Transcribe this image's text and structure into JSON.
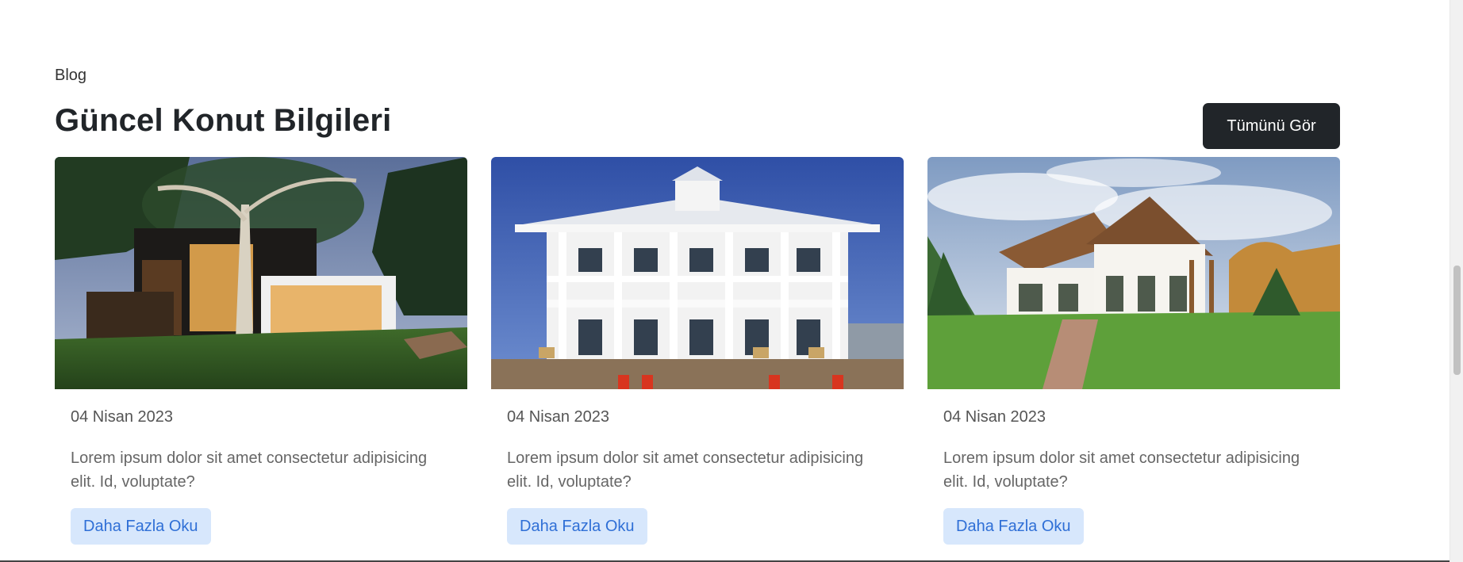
{
  "section": {
    "eyebrow": "Blog",
    "title": "Güncel Konut Bilgileri",
    "see_all_label": "Tümünü Gör"
  },
  "cards": [
    {
      "image_alt": "modern-house-at-dusk",
      "date": "04 Nisan 2023",
      "excerpt": "Lorem ipsum dolor sit amet consectetur adipisicing elit. Id, voluptate?",
      "button_label": "Daha Fazla Oku"
    },
    {
      "image_alt": "white-colonial-house",
      "date": "04 Nisan 2023",
      "excerpt": "Lorem ipsum dolor sit amet consectetur adipisicing elit. Id, voluptate?",
      "button_label": "Daha Fazla Oku"
    },
    {
      "image_alt": "country-house-with-garden",
      "date": "04 Nisan 2023",
      "excerpt": "Lorem ipsum dolor sit amet consectetur adipisicing elit. Id, voluptate?",
      "button_label": "Daha Fazla Oku"
    }
  ],
  "colors": {
    "dark_button": "#212529",
    "read_more_bg": "#d7e7fc",
    "read_more_text": "#2f6fd6"
  }
}
